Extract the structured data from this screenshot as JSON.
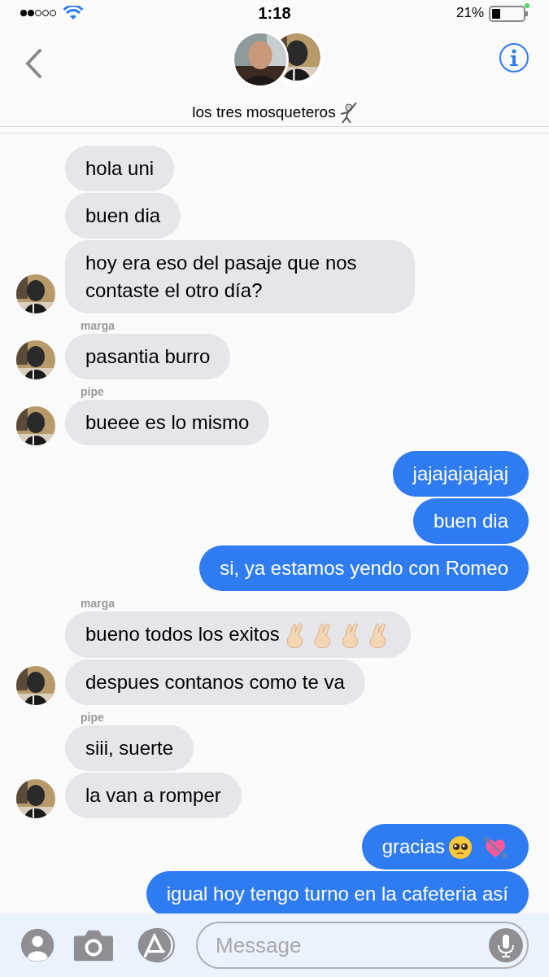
{
  "status_bar": {
    "time": "1:18",
    "battery": "21%"
  },
  "header": {
    "title": "los tres mosqueteros",
    "title_icon": {
      "kind": "fencer"
    }
  },
  "groups": [
    {
      "kind": "incoming",
      "messages": [
        {
          "text": "hola uni"
        },
        {
          "text": "buen dia"
        },
        {
          "text": "hoy era eso del pasaje que nos contaste el otro día?"
        }
      ]
    },
    {
      "kind": "incoming",
      "sender": "marga",
      "messages": [
        {
          "text": "pasantia burro"
        }
      ]
    },
    {
      "kind": "incoming",
      "sender": "pipe",
      "messages": [
        {
          "text": "bueee es lo mismo"
        }
      ]
    },
    {
      "kind": "outgoing",
      "messages": [
        {
          "text": "jajajajajajaj"
        },
        {
          "text": "buen dia"
        },
        {
          "text": "si, ya estamos yendo con Romeo"
        }
      ]
    },
    {
      "kind": "incoming",
      "sender": "marga",
      "messages": [
        {
          "text": "bueno todos los exitos",
          "emojis": [
            {
              "kind": "fingers"
            },
            {
              "kind": "fingers"
            },
            {
              "kind": "fingers"
            },
            {
              "kind": "fingers"
            }
          ]
        },
        {
          "text": "despues contanos como te va"
        }
      ]
    },
    {
      "kind": "incoming",
      "sender": "pipe",
      "messages": [
        {
          "text": "siii, suerte"
        },
        {
          "text": "la van a romper"
        }
      ]
    },
    {
      "kind": "outgoing",
      "messages": [
        {
          "text": "gracias",
          "emojis": [
            {
              "kind": "pleading"
            },
            {
              "kind": "heart-arrow"
            }
          ]
        },
        {
          "text": "igual hoy tengo turno en la cafeteria así"
        }
      ]
    }
  ],
  "composer": {
    "placeholder": "Message"
  }
}
